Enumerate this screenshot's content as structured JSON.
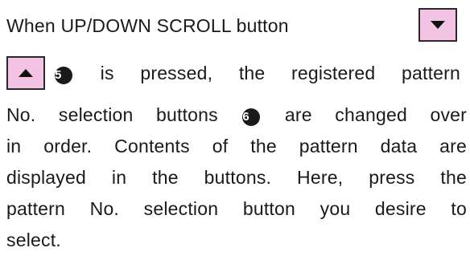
{
  "doc": {
    "line1": "When UP/DOWN SCROLL button",
    "down_icon": "down-triangle",
    "up_icon": "up-triangle",
    "line2_a": "5",
    "line2_b": "is pressed, the registered pattern",
    "line3_a": "No. selection buttons",
    "line3_num": "6",
    "line3_b": "are changed over",
    "line4": "in order. Contents of the pattern data are",
    "line5": "displayed in the buttons. Here, press the",
    "line6": "pattern No. selection button you desire to",
    "line7": "select.",
    "button_color": "#f3c3e3"
  }
}
